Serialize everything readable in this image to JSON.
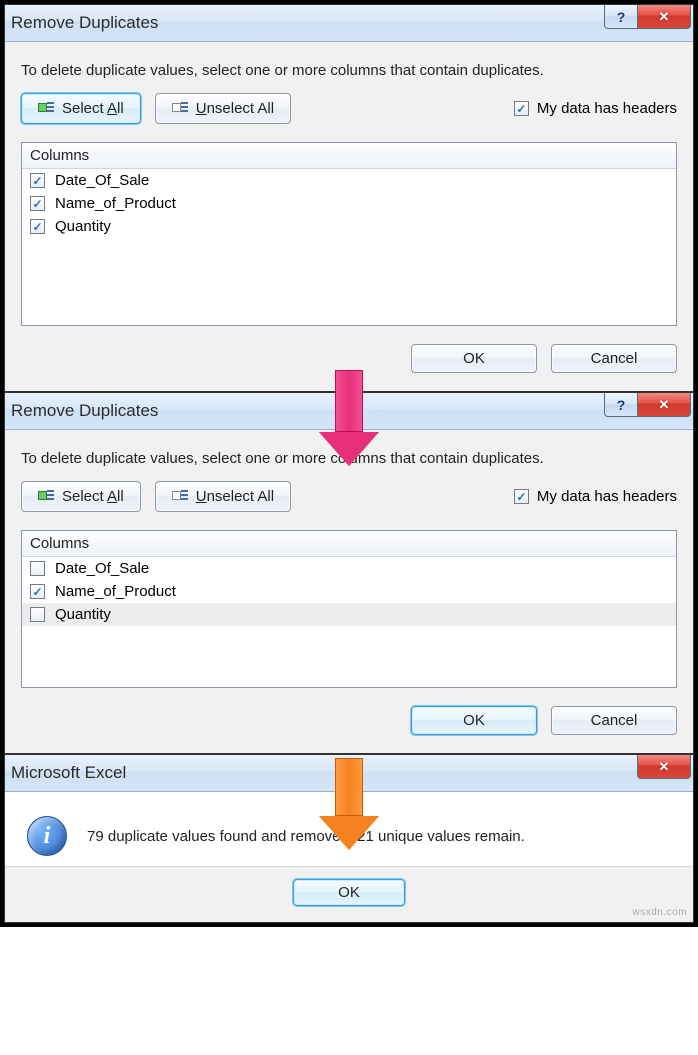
{
  "dialog1": {
    "title": "Remove Duplicates",
    "instruction": "To delete duplicate values, select one or more columns that contain duplicates.",
    "select_all_label": "Select All",
    "select_all_hotkey": "A",
    "unselect_all_label": "Unselect All",
    "unselect_all_hotkey": "U",
    "headers_label": "My data has headers",
    "headers_hotkey": "M",
    "headers_checked": true,
    "columns_header": "Columns",
    "columns": [
      {
        "label": "Date_Of_Sale",
        "checked": true
      },
      {
        "label": "Name_of_Product",
        "checked": true
      },
      {
        "label": "Quantity",
        "checked": true
      }
    ],
    "ok_label": "OK",
    "cancel_label": "Cancel",
    "select_all_highlight": true
  },
  "dialog2": {
    "title": "Remove Duplicates",
    "instruction": "To delete duplicate values, select one or more columns that contain duplicates.",
    "select_all_label": "Select All",
    "select_all_hotkey": "A",
    "unselect_all_label": "Unselect All",
    "unselect_all_hotkey": "U",
    "headers_label": "My data has headers",
    "headers_hotkey": "M",
    "headers_checked": true,
    "columns_header": "Columns",
    "columns": [
      {
        "label": "Date_Of_Sale",
        "checked": false,
        "selected": false
      },
      {
        "label": "Name_of_Product",
        "checked": true,
        "selected": false
      },
      {
        "label": "Quantity",
        "checked": false,
        "selected": true
      }
    ],
    "ok_label": "OK",
    "cancel_label": "Cancel",
    "ok_highlight": true
  },
  "msgbox": {
    "title": "Microsoft Excel",
    "message": "79 duplicate values found and removed; 21 unique values remain.",
    "ok_label": "OK",
    "ok_highlight": true
  },
  "arrows": {
    "arrow1_color": "#e8307a",
    "arrow2_color": "#f5821f"
  },
  "watermark": "wsxdn.com"
}
